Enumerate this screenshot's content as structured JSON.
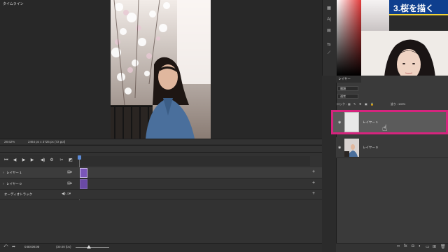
{
  "canvas": {
    "zoom": "28.62%",
    "doc_size": "2464 px x 3725 px (72 ppi)"
  },
  "timeline": {
    "tab_label": "タイムライン",
    "tracks": [
      {
        "label": "レイヤー 1"
      },
      {
        "label": "レイヤー 0"
      },
      {
        "label": "オーディオトラック"
      }
    ],
    "timecode": "0:00:00:00",
    "fps": "(30.00 fps)"
  },
  "title_card": {
    "text": "3.桜を描く",
    "bg_color": "#0f3f8e",
    "accent_color": "#f2d43a"
  },
  "layers_panel": {
    "tab_label": "レイヤー",
    "kind_filter": "種類",
    "blend_mode": "通常",
    "lock_label": "ロック :",
    "fill_label": "塗り :",
    "fill_value": "100%",
    "layers": [
      {
        "name": "レイヤー 1",
        "selected": true
      },
      {
        "name": "レイヤー 0",
        "selected": false
      }
    ],
    "highlight_color": "#d6247e"
  }
}
